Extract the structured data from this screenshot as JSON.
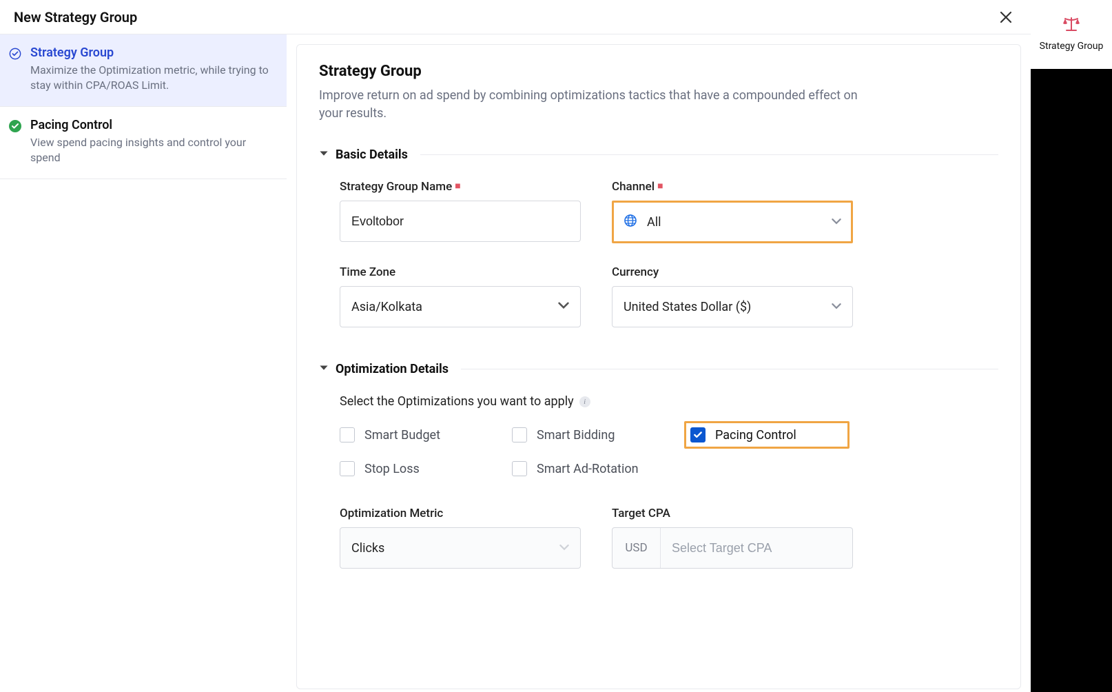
{
  "header": {
    "title": "New Strategy Group"
  },
  "rail": {
    "item_label": "Strategy Group"
  },
  "sidebar": {
    "items": [
      {
        "title": "Strategy Group",
        "desc": "Maximize the Optimization metric, while trying to stay within CPA/ROAS Limit."
      },
      {
        "title": "Pacing Control",
        "desc": "View spend pacing insights and control your spend"
      }
    ]
  },
  "content": {
    "title": "Strategy Group",
    "desc": "Improve return on ad spend by combining optimizations tactics that have a compounded effect on your results.",
    "sections": {
      "basic": {
        "heading": "Basic Details",
        "fields": {
          "name": {
            "label": "Strategy Group Name",
            "value": "Evoltobor"
          },
          "channel": {
            "label": "Channel",
            "value": "All"
          },
          "timezone": {
            "label": "Time Zone",
            "value": "Asia/Kolkata"
          },
          "currency": {
            "label": "Currency",
            "value": "United States Dollar ($)"
          }
        }
      },
      "opt": {
        "heading": "Optimization Details",
        "prompt": "Select the Optimizations you want to apply",
        "checks": {
          "smart_budget": "Smart Budget",
          "smart_bidding": "Smart Bidding",
          "pacing_control": "Pacing Control",
          "stop_loss": "Stop Loss",
          "smart_ad_rotation": "Smart Ad-Rotation"
        },
        "metric": {
          "label": "Optimization Metric",
          "value": "Clicks"
        },
        "target_cpa": {
          "label": "Target CPA",
          "prefix": "USD",
          "placeholder": "Select Target CPA"
        }
      }
    }
  }
}
